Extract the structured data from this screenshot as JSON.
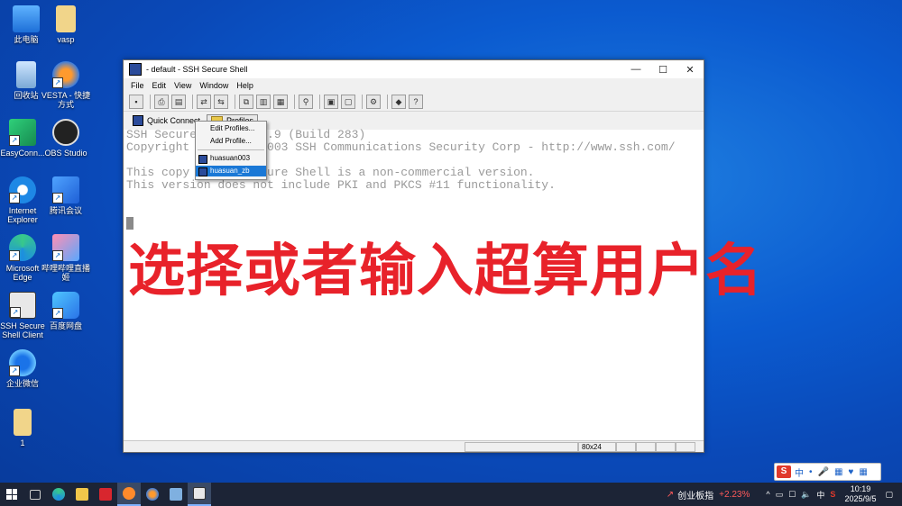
{
  "desktop": {
    "icons": [
      {
        "label": "此电脑",
        "icon": "computer-icon"
      },
      {
        "label": "vasp",
        "icon": "folder-icon"
      },
      {
        "label": "回收站",
        "icon": "recycle-bin-icon"
      },
      {
        "label": "VESTA - 快捷方式",
        "icon": "vesta-icon"
      },
      {
        "label": "EasyConn...",
        "icon": "easyconnect-icon"
      },
      {
        "label": "OBS Studio",
        "icon": "obs-icon"
      },
      {
        "label": "Internet Explorer",
        "icon": "ie-icon"
      },
      {
        "label": "腾讯会议",
        "icon": "tencent-meeting-icon"
      },
      {
        "label": "Microsoft Edge",
        "icon": "edge-icon"
      },
      {
        "label": "哔哩哔哩直播姬",
        "icon": "bilibili-live-icon"
      },
      {
        "label": "SSH Secure Shell Client",
        "icon": "ssh-client-icon"
      },
      {
        "label": "百度网盘",
        "icon": "baidu-netdisk-icon"
      },
      {
        "label": "企业微信",
        "icon": "wecom-icon"
      },
      {
        "label": "1",
        "icon": "folder-icon"
      }
    ]
  },
  "window": {
    "title": "- default - SSH Secure Shell",
    "controls": {
      "minimize": "—",
      "maximize": "☐",
      "close": "✕"
    },
    "menu": [
      "File",
      "Edit",
      "View",
      "Window",
      "Help"
    ],
    "quick_connect": "Quick Connect",
    "profiles": "Profiles",
    "terminal_lines": [
      "SSH Secure Shell 3.2.9 (Build 283)",
      "Copyright (c) 2000-2003 SSH Communications Security Corp - http://www.ssh.com/",
      "",
      "This copy of SSH Secure Shell is a non-commercial version.",
      "This version does not include PKI and PKCS #11 functionality."
    ],
    "status_size": "80x24"
  },
  "profiles_menu": {
    "edit": "Edit Profiles...",
    "add": "Add Profile...",
    "items": [
      "huasuan003",
      "huasuan_zb"
    ],
    "selected": "huasuan_zb"
  },
  "overlay_text": "选择或者输入超算用户名",
  "ime": {
    "badge": "S",
    "items": [
      "中",
      "•",
      "🎤",
      "▦",
      "♥",
      "▦"
    ]
  },
  "taskbar": {
    "stock_name": "创业板指",
    "stock_change": "+2.23%",
    "tray_lang": "中",
    "time": "10:19",
    "date": "2025/9/5"
  },
  "colors": {
    "overlay": "#e8222a",
    "selection": "#1a78d6",
    "stock_change": "#ff5a5a"
  }
}
